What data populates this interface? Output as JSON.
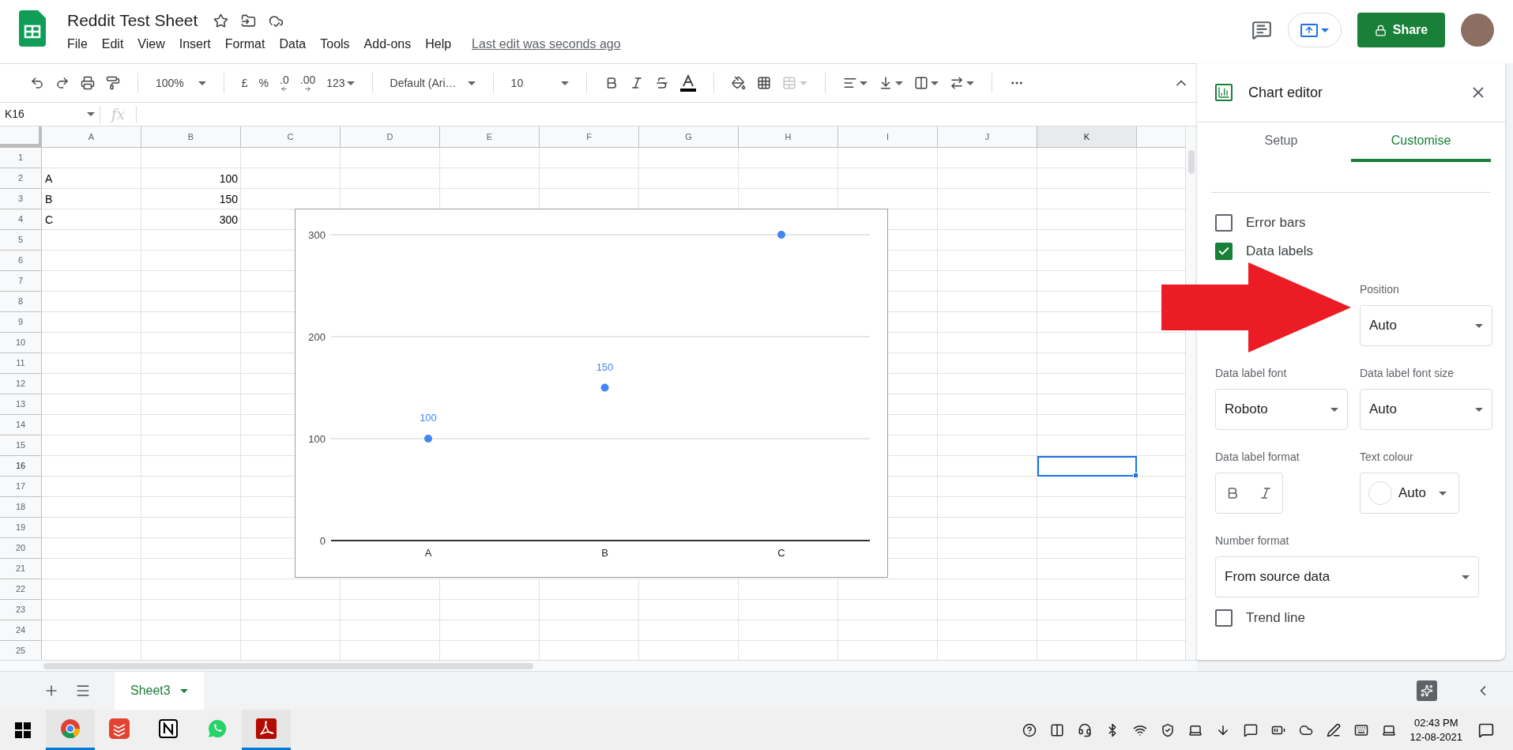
{
  "app": {
    "title": "Reddit Test Sheet",
    "menu": [
      "File",
      "Edit",
      "View",
      "Insert",
      "Format",
      "Data",
      "Tools",
      "Add-ons",
      "Help"
    ],
    "last_edit": "Last edit was seconds ago",
    "share": "Share"
  },
  "toolbar": {
    "zoom": "100%",
    "currency": "£",
    "percent": "%",
    "decrease_decimals": ".0",
    "increase_decimals": ".00",
    "number_format": "123",
    "font": "Default (Ari…",
    "font_size": "10"
  },
  "formula_bar": {
    "name_box": "K16",
    "fx": "fx"
  },
  "grid": {
    "columns": [
      {
        "label": "A",
        "selected": false
      },
      {
        "label": "B",
        "selected": false
      },
      {
        "label": "C",
        "selected": false
      },
      {
        "label": "D",
        "selected": false
      },
      {
        "label": "E",
        "selected": false
      },
      {
        "label": "F",
        "selected": false
      },
      {
        "label": "G",
        "selected": false
      },
      {
        "label": "H",
        "selected": false
      },
      {
        "label": "I",
        "selected": false
      },
      {
        "label": "J",
        "selected": false
      },
      {
        "label": "K",
        "selected": true
      }
    ],
    "rows": [
      {
        "label": "1",
        "selected": false
      },
      {
        "label": "2",
        "selected": false,
        "cells": [
          {
            "kind": "text",
            "text": "A"
          },
          {
            "kind": "number",
            "text": "100"
          }
        ]
      },
      {
        "label": "3",
        "selected": false,
        "cells": [
          {
            "kind": "text",
            "text": "B"
          },
          {
            "kind": "number",
            "text": "150"
          }
        ]
      },
      {
        "label": "4",
        "selected": false,
        "cells": [
          {
            "kind": "text",
            "text": "C"
          },
          {
            "kind": "number",
            "text": "300"
          }
        ]
      },
      {
        "label": "5",
        "selected": false
      },
      {
        "label": "6",
        "selected": false
      },
      {
        "label": "7",
        "selected": false
      },
      {
        "label": "8",
        "selected": false
      },
      {
        "label": "9",
        "selected": false
      },
      {
        "label": "10",
        "selected": false
      },
      {
        "label": "11",
        "selected": false
      },
      {
        "label": "12",
        "selected": false
      },
      {
        "label": "13",
        "selected": false
      },
      {
        "label": "14",
        "selected": false
      },
      {
        "label": "15",
        "selected": false
      },
      {
        "label": "16",
        "selected": true
      },
      {
        "label": "17",
        "selected": false
      },
      {
        "label": "18",
        "selected": false
      },
      {
        "label": "19",
        "selected": false
      },
      {
        "label": "20",
        "selected": false
      },
      {
        "label": "21",
        "selected": false
      },
      {
        "label": "22",
        "selected": false
      },
      {
        "label": "23",
        "selected": false
      },
      {
        "label": "24",
        "selected": false
      },
      {
        "label": "25",
        "selected": false
      }
    ]
  },
  "chart": {
    "chart_data": {
      "type": "scatter",
      "categories": [
        "A",
        "B",
        "C"
      ],
      "series": [
        {
          "color": "#4285f4",
          "values": [
            100,
            150,
            300
          ]
        }
      ],
      "ylim": [
        0,
        300
      ],
      "yticks": [
        0,
        100,
        200,
        300
      ],
      "value_labels": [
        "100",
        "150",
        null
      ]
    }
  },
  "chart_editor": {
    "title": "Chart editor",
    "tabs": [
      {
        "label": "Setup",
        "selected": false
      },
      {
        "label": "Customise",
        "selected": true
      }
    ],
    "checkboxes": [
      {
        "label": "Error bars",
        "checked": false
      },
      {
        "label": "Data labels",
        "checked": true
      }
    ],
    "fields": [
      {
        "kind": "dropdown",
        "label": "Position",
        "value": "Auto"
      },
      {
        "kind": "dropdown",
        "label": "Data label font",
        "value": "Roboto"
      },
      {
        "kind": "dropdown",
        "label": "Data label font size",
        "value": "Auto"
      },
      {
        "kind": "format",
        "label": "Data label format"
      },
      {
        "kind": "color",
        "label": "Text colour",
        "value": "Auto"
      },
      {
        "kind": "wide",
        "label": "Number format",
        "value": "From source data"
      }
    ],
    "trend_line": {
      "label": "Trend line",
      "checked": false
    }
  },
  "sheets": [
    {
      "label": "Sheet3",
      "selected": true
    }
  ],
  "taskbar": {
    "apps": [
      {
        "kind": "chrome",
        "running": true
      },
      {
        "kind": "todo",
        "running": false
      },
      {
        "kind": "notion",
        "running": false
      },
      {
        "kind": "chat",
        "running": false
      },
      {
        "kind": "pdf",
        "running": true
      }
    ],
    "time": "02:43 PM",
    "date": "12-08-2021"
  }
}
